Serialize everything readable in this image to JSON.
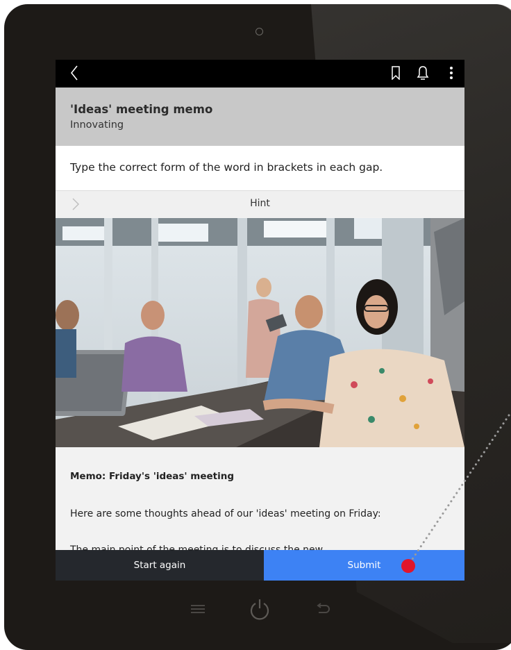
{
  "app": {
    "title": "'Ideas' meeting memo",
    "subtitle": "Innovating"
  },
  "topbar": {
    "icons": [
      "back-icon",
      "bookmark-icon",
      "bell-icon",
      "more-icon"
    ]
  },
  "instruction": "Type the correct form of the word in brackets in each gap.",
  "hint": {
    "label": "Hint",
    "icon": "chevron-right-icon"
  },
  "memo": {
    "heading": "Memo: Friday's 'ideas' meeting",
    "intro": "Here are some thoughts ahead of our 'ideas' meeting on Friday:",
    "line": "The main point of the meeting is to discuss the new"
  },
  "footer": {
    "start_again": "Start again",
    "submit": "Submit"
  },
  "device": {
    "home_icons": [
      "menu-icon",
      "power-icon",
      "return-icon"
    ]
  },
  "colors": {
    "submit": "#3d82f4",
    "start_again": "#25282d",
    "header": "#c8c8c8",
    "cursor_marker": "#e0152b"
  }
}
